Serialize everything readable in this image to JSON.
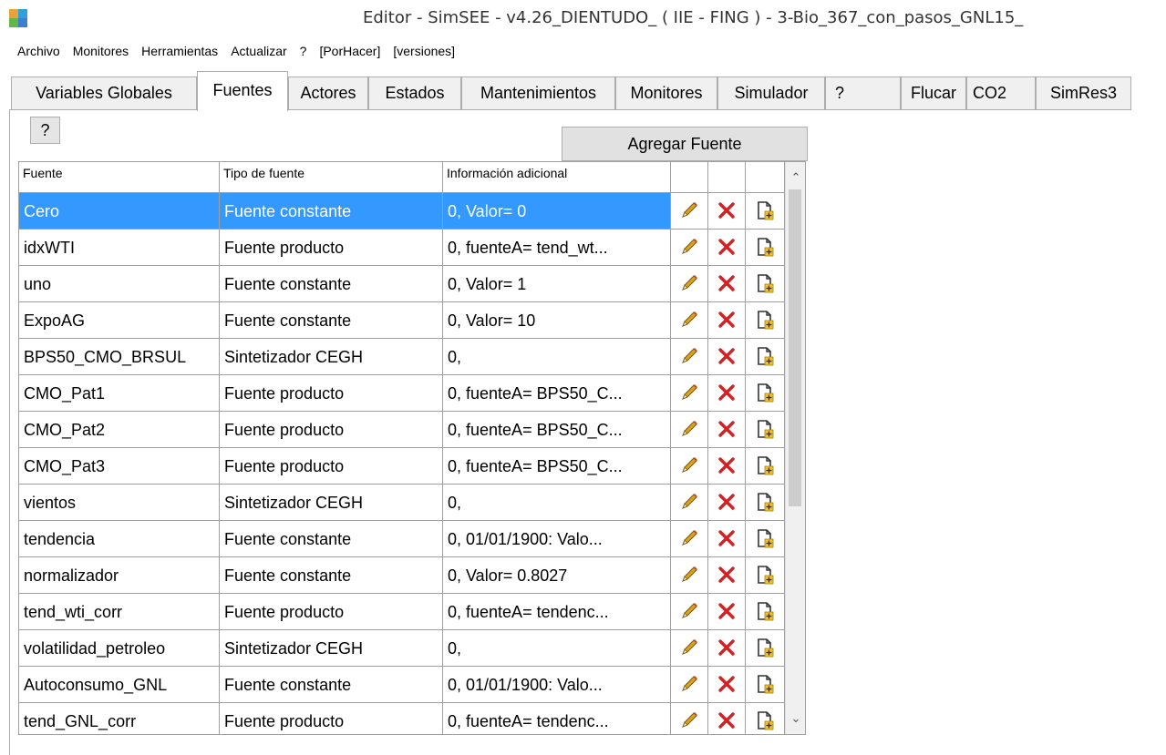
{
  "window": {
    "title": "Editor - SimSEE - v4.26_DIENTUDO_ ( IIE - FING ) - 3-Bio_367_con_pasos_GNL15_"
  },
  "menu": [
    "Archivo",
    "Monitores",
    "Herramientas",
    "Actualizar",
    "?",
    "[PorHacer]",
    "[versiones]"
  ],
  "tabs": [
    {
      "label": "Variables Globales"
    },
    {
      "label": "Fuentes"
    },
    {
      "label": "Actores"
    },
    {
      "label": "Estados"
    },
    {
      "label": "Mantenimientos"
    },
    {
      "label": "Monitores"
    },
    {
      "label": "Simulador"
    },
    {
      "label": "?"
    },
    {
      "label": "Flucar"
    },
    {
      "label": "CO2"
    },
    {
      "label": "SimRes3"
    }
  ],
  "active_tab": "Fuentes",
  "toolbar": {
    "help_label": "?",
    "add_label": "Agregar Fuente"
  },
  "table": {
    "columns": [
      "Fuente",
      "Tipo de fuente",
      "Información adicional",
      "",
      "",
      ""
    ],
    "rows": [
      {
        "fuente": "Cero",
        "tipo": "Fuente constante",
        "info": "0,  Valor= 0",
        "selected": true
      },
      {
        "fuente": "idxWTI",
        "tipo": "Fuente producto",
        "info": "0,  fuenteA= tend_wt..."
      },
      {
        "fuente": "uno",
        "tipo": "Fuente constante",
        "info": "0,  Valor= 1"
      },
      {
        "fuente": "ExpoAG",
        "tipo": "Fuente constante",
        "info": "0,  Valor= 10"
      },
      {
        "fuente": "BPS50_CMO_BRSUL",
        "tipo": "Sintetizador CEGH",
        "info": "0,"
      },
      {
        "fuente": "CMO_Pat1",
        "tipo": "Fuente producto",
        "info": "0,  fuenteA= BPS50_C..."
      },
      {
        "fuente": "CMO_Pat2",
        "tipo": "Fuente producto",
        "info": "0,  fuenteA= BPS50_C..."
      },
      {
        "fuente": "CMO_Pat3",
        "tipo": "Fuente producto",
        "info": "0,  fuenteA= BPS50_C..."
      },
      {
        "fuente": "vientos",
        "tipo": "Sintetizador CEGH",
        "info": "0,"
      },
      {
        "fuente": "tendencia",
        "tipo": "Fuente constante",
        "info": "0,  01/01/1900: Valo..."
      },
      {
        "fuente": "normalizador",
        "tipo": "Fuente constante",
        "info": "0,  Valor= 0.8027"
      },
      {
        "fuente": "tend_wti_corr",
        "tipo": "Fuente producto",
        "info": "0,  fuenteA= tendenc..."
      },
      {
        "fuente": "volatilidad_petroleo",
        "tipo": "Sintetizador CEGH",
        "info": "0,"
      },
      {
        "fuente": "Autoconsumo_GNL",
        "tipo": "Fuente constante",
        "info": "0,  01/01/1900: Valo..."
      },
      {
        "fuente": "tend_GNL_corr",
        "tipo": "Fuente producto",
        "info": "0,  fuenteA= tendenc..."
      }
    ]
  },
  "colors": {
    "selection": "#3399ff",
    "edit_icon": "#d9a21a",
    "delete_icon": "#d42020",
    "clone_icon": "#333333"
  },
  "icons": [
    "edit-icon",
    "delete-icon",
    "clone-icon"
  ]
}
